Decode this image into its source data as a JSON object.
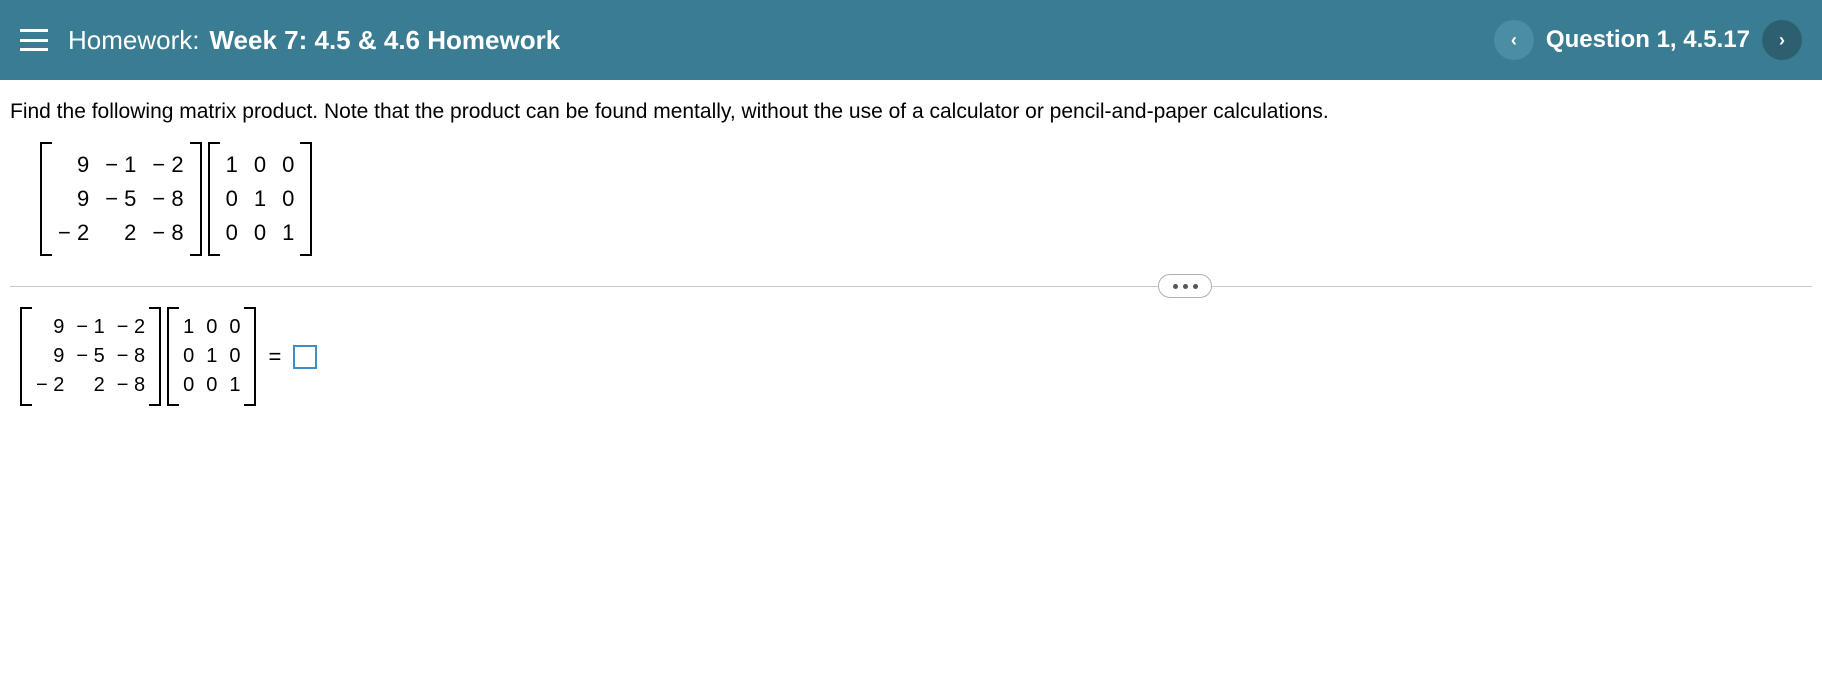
{
  "header": {
    "title_label": "Homework:",
    "title_value": "Week 7: 4.5 & 4.6 Homework",
    "question_label": "Question 1, 4.5.17",
    "prev_glyph": "‹",
    "next_glyph": "›"
  },
  "prompt": "Find the following matrix product. Note that the product can be found mentally, without the use of a calculator or pencil-and-paper calculations.",
  "matrixA": [
    [
      "9",
      "− 1",
      "− 2"
    ],
    [
      "9",
      "− 5",
      "− 8"
    ],
    [
      "− 2",
      "2",
      "− 8"
    ]
  ],
  "matrixB": [
    [
      "1",
      "0",
      "0"
    ],
    [
      "0",
      "1",
      "0"
    ],
    [
      "0",
      "0",
      "1"
    ]
  ],
  "equals": "="
}
